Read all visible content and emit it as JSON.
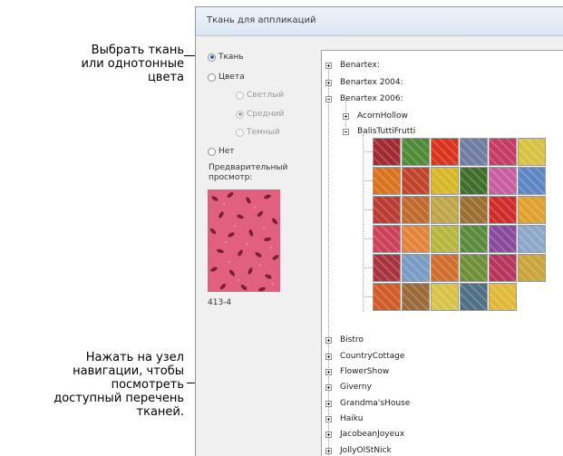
{
  "callouts": {
    "fabric": [
      "Выбрать ткань",
      "или однотонные",
      "цвета"
    ],
    "node": [
      "Нажать на узел",
      "навигации, чтобы",
      "посмотреть",
      "доступный перечень",
      "тканей."
    ]
  },
  "dialog": {
    "title": "Ткань для аппликаций",
    "options": {
      "fabric": "Ткань",
      "colors": "Цвета",
      "light": "Светлый",
      "medium": "Средний",
      "dark": "Темный",
      "none": "Нет"
    },
    "preview_label_line1": "Предварительный",
    "preview_label_line2": "просмотр:",
    "preview_code": "413-4",
    "tree": {
      "top_nodes": [
        "Benartex:",
        "Benartex 2004:",
        "Benartex 2006:"
      ],
      "child_nodes": [
        "AcornHollow",
        "BalisTuttiFrutti"
      ],
      "bottom_nodes": [
        "Bistro",
        "CountryCottage",
        "FlowerShow",
        "Giverny",
        "Grandma'sHouse",
        "Haiku",
        "JacobeanJoyeux",
        "JollyOlStNick"
      ]
    },
    "swatch_colors": [
      "#a02a32",
      "#4f8a36",
      "#d8331e",
      "#6f7da2",
      "#c43c66",
      "#d8c244",
      "#d9731f",
      "#c0442c",
      "#d8b62a",
      "#3f6e2c",
      "#c85ea0",
      "#5f86c4",
      "#b83b34",
      "#c06a2e",
      "#bfa648",
      "#9b6f31",
      "#cf2b2a",
      "#dfa02e",
      "#cc4058",
      "#e2853a",
      "#b7b73f",
      "#5a8b3c",
      "#8a4a9c",
      "#8da7c9",
      "#a8333e",
      "#7a9bc4",
      "#d06e2e",
      "#6f8f3a",
      "#b5355c",
      "#c9a43a",
      "#cf5a2a",
      "#9a6a3a",
      "#d7c24a",
      "#4e6f84",
      "#e0b83a"
    ]
  }
}
